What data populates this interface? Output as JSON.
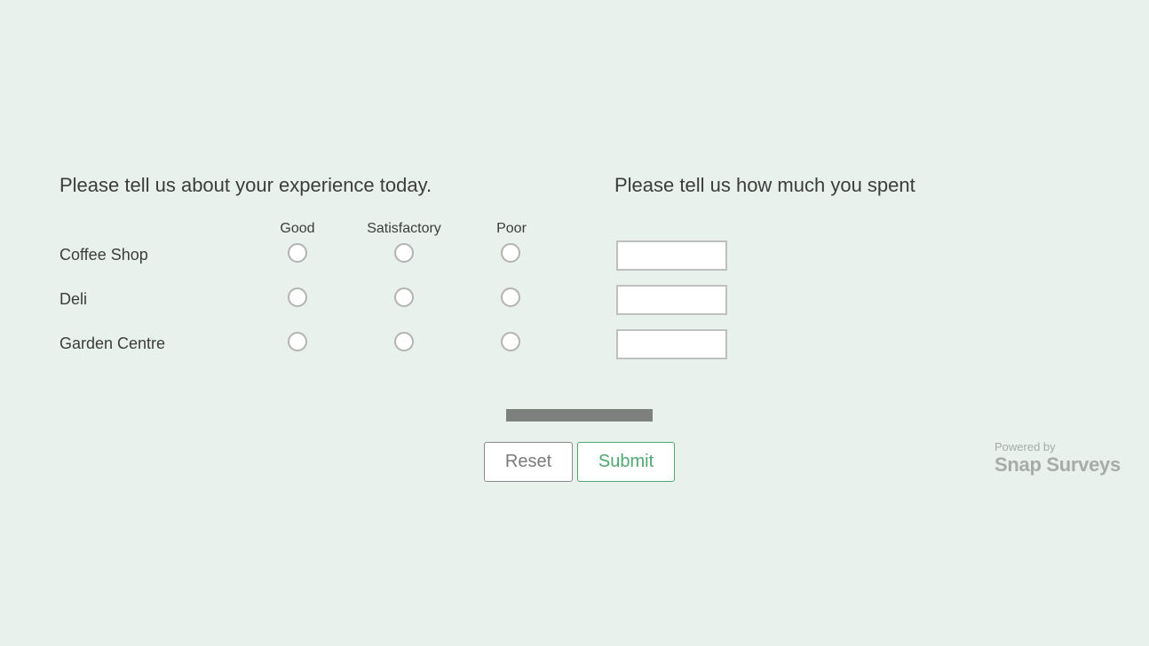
{
  "survey": {
    "question1": {
      "title": "Please tell us about your experience today.",
      "columns": [
        "Good",
        "Satisfactory",
        "Poor"
      ],
      "rows": [
        "Coffee Shop",
        "Deli",
        "Garden Centre"
      ]
    },
    "question2": {
      "title": "Please tell us how much you spent",
      "inputs": [
        {
          "value": "",
          "placeholder": ""
        },
        {
          "value": "",
          "placeholder": ""
        },
        {
          "value": "",
          "placeholder": ""
        }
      ]
    }
  },
  "progress": {
    "fraction": 1.0
  },
  "buttons": {
    "reset": "Reset",
    "submit": "Submit"
  },
  "footer": {
    "powered_by": "Powered by",
    "brand": "Snap Surveys"
  },
  "colors": {
    "background": "#e8f1ec",
    "accent": "#4ea86f",
    "progress": "#7d807e",
    "text": "#3c3c3c"
  }
}
